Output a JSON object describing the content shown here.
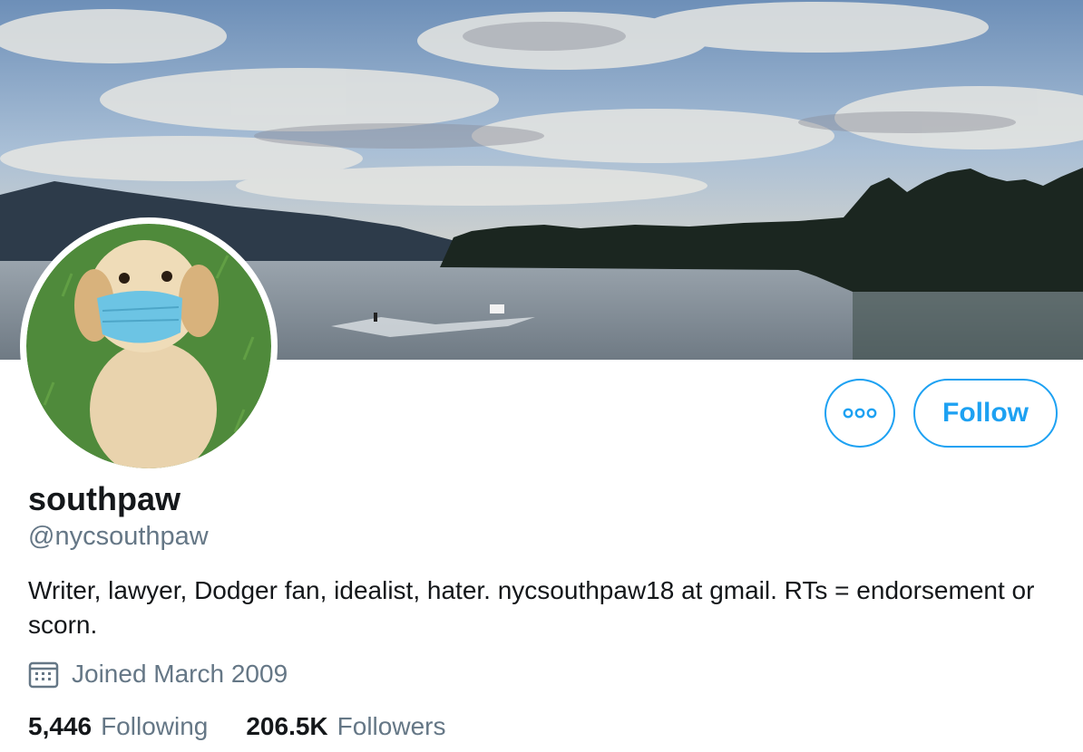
{
  "profile": {
    "display_name": "southpaw",
    "handle": "@nycsouthpaw",
    "bio": "Writer, lawyer, Dodger fan, idealist, hater. nycsouthpaw18 at gmail. RTs = endorsement or scorn.",
    "joined": "Joined March 2009"
  },
  "actions": {
    "more_icon": "more-dots-icon",
    "follow_label": "Follow"
  },
  "stats": {
    "following_count": "5,446",
    "following_label": "Following",
    "followers_count": "206.5K",
    "followers_label": "Followers"
  },
  "colors": {
    "accent": "#1da1f2",
    "text_primary": "#14171a",
    "text_secondary": "#657786"
  }
}
